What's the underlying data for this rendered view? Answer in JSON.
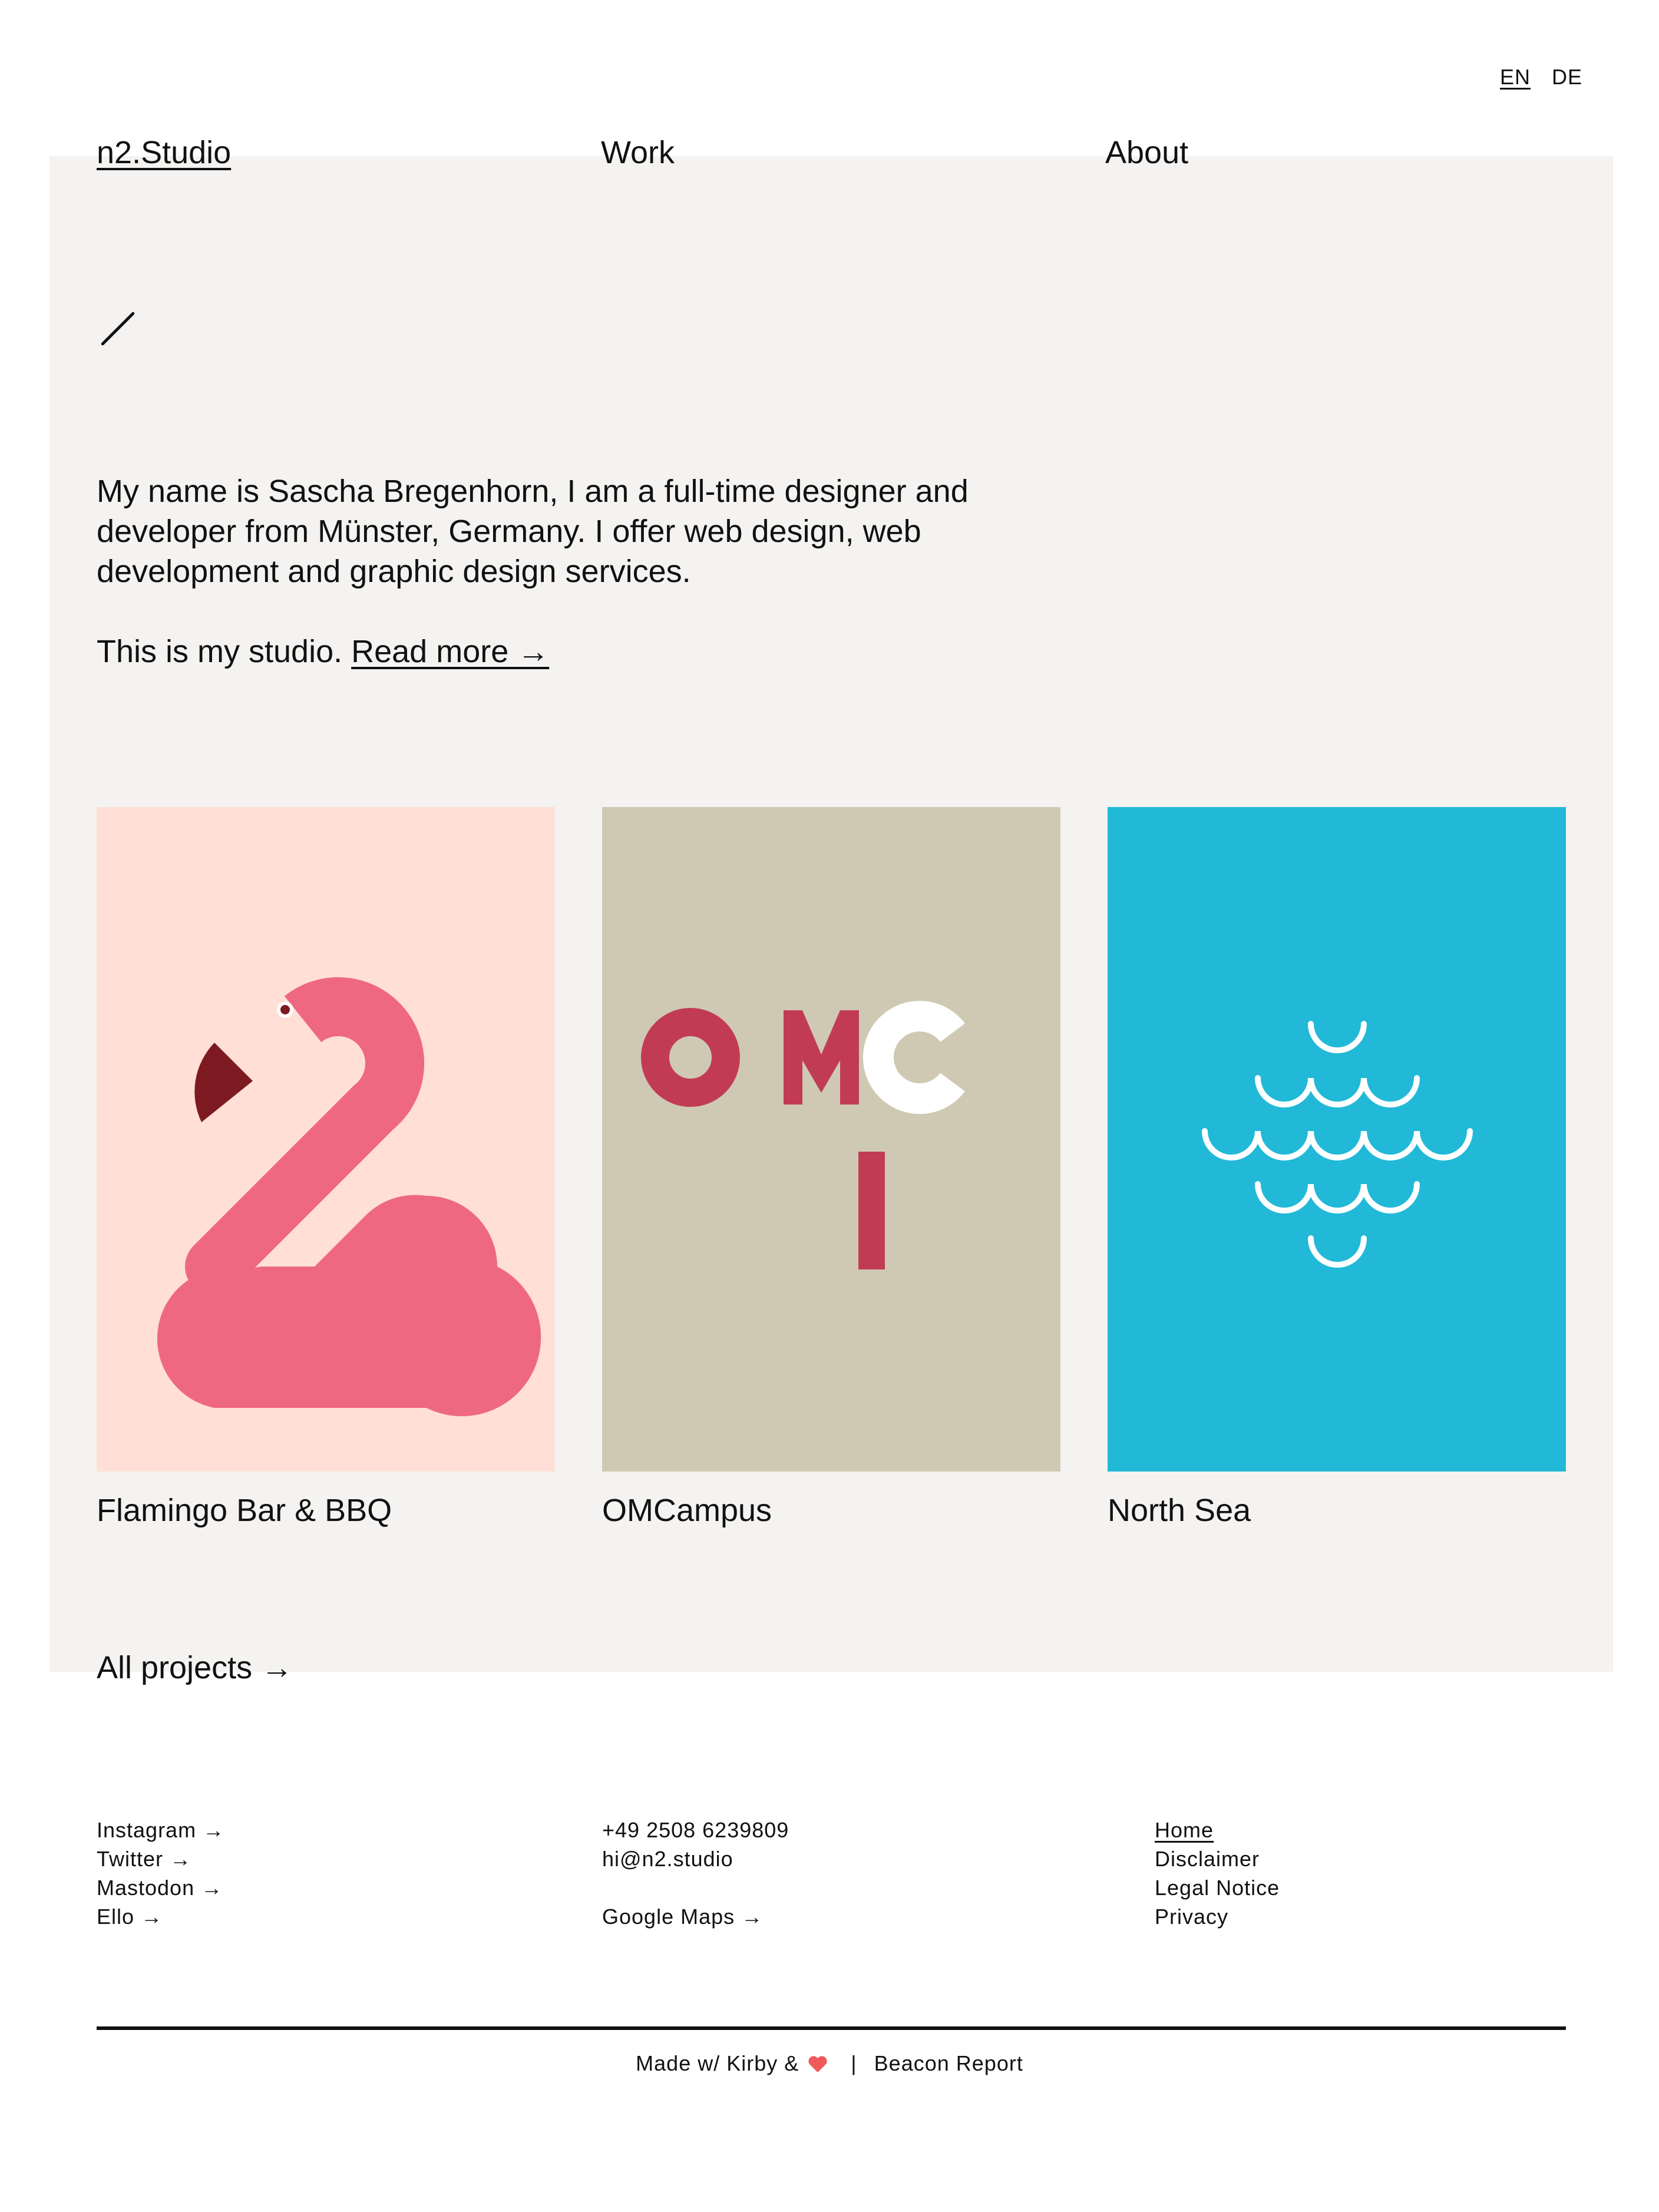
{
  "lang": {
    "en": "EN",
    "de": "DE"
  },
  "nav": {
    "brand": "n2.Studio",
    "work": "Work",
    "about": "About"
  },
  "intro": {
    "paragraph": "My name is Sascha Bregenhorn, I am a full-time designer and developer from Münster, Germany. I offer web design, web development and graphic design services.",
    "studio_text": "This is my studio.",
    "read_more": "Read more →"
  },
  "projects": [
    {
      "title": "Flamingo Bar & BBQ",
      "bg": "#ffdfd6",
      "icon": "flamingo-icon"
    },
    {
      "title": "OMCampus",
      "bg": "#cfc9b3",
      "icon": "omc-logo"
    },
    {
      "title": "North Sea",
      "bg": "#21b9d7",
      "icon": "waves-icon"
    }
  ],
  "all_projects": "All projects →",
  "footer": {
    "social": [
      "Instagram →",
      "Twitter →",
      "Mastodon →",
      "Ello →"
    ],
    "contact": {
      "phone": "+49 2508 6239809",
      "email": "hi@n2.studio",
      "maps": "Google Maps →"
    },
    "legal": [
      "Home",
      "Disclaimer",
      "Legal Notice",
      "Privacy"
    ]
  },
  "credits": {
    "made_with": "Made w/ Kirby &",
    "separator": "|",
    "beacon": "Beacon Report"
  },
  "colors": {
    "panel": "#f4f3f1",
    "flamingo_pink": "#ef6882",
    "flamingo_beak": "#7d1a21",
    "omc_red": "#c23b55",
    "heart": "#f05a5a"
  }
}
